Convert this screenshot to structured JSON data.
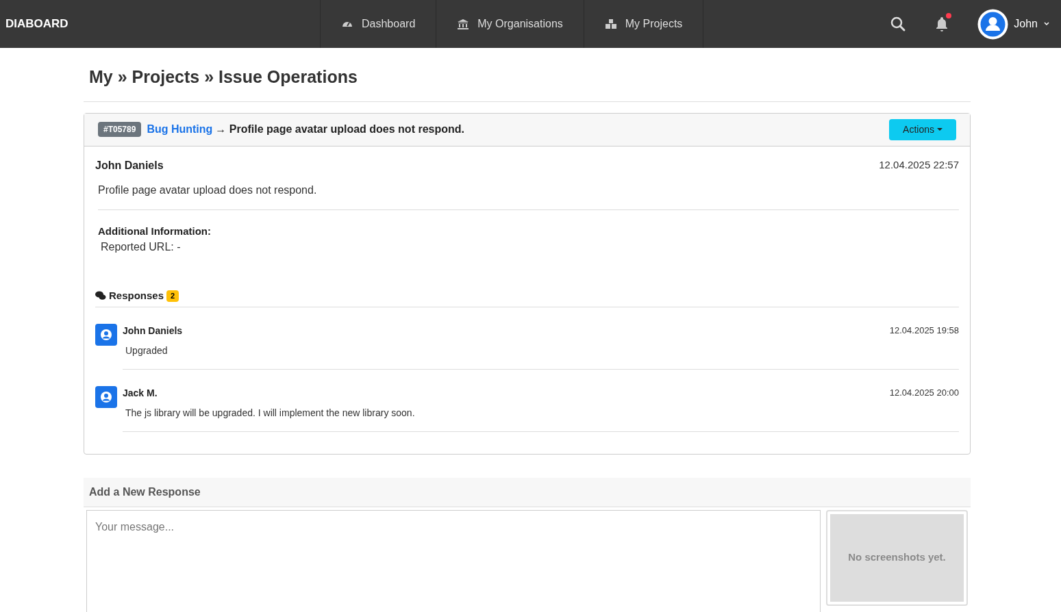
{
  "navbar": {
    "brand": "DIABOARD",
    "items": [
      {
        "label": "Dashboard"
      },
      {
        "label": "My Organisations"
      },
      {
        "label": "My Projects"
      }
    ],
    "notifications": {
      "unread": true
    },
    "user": {
      "name": "John"
    }
  },
  "breadcrumb": "My » Projects » Issue Operations",
  "issue": {
    "id": "#T05789",
    "project": "Bug Hunting",
    "arrow": "→",
    "title": "Profile page avatar upload does not respond.",
    "actions_button": "Actions",
    "author": "John Daniels",
    "date": "12.04.2025 22:57",
    "description": "Profile page avatar upload does not respond.",
    "additional_heading": "Additional Information:",
    "reported_url": "Reported URL: -"
  },
  "responses": {
    "heading": "Responses",
    "count": "2",
    "items": [
      {
        "author": "John Daniels",
        "date": "12.04.2025 19:58",
        "text": "Upgraded"
      },
      {
        "author": "Jack M.",
        "date": "12.04.2025 20:00",
        "text": "The js library will be upgraded. I will implement the new library soon."
      }
    ]
  },
  "new_response": {
    "heading": "Add a New Response",
    "placeholder": "Your message...",
    "screenshots_empty": "No screenshots yet."
  }
}
